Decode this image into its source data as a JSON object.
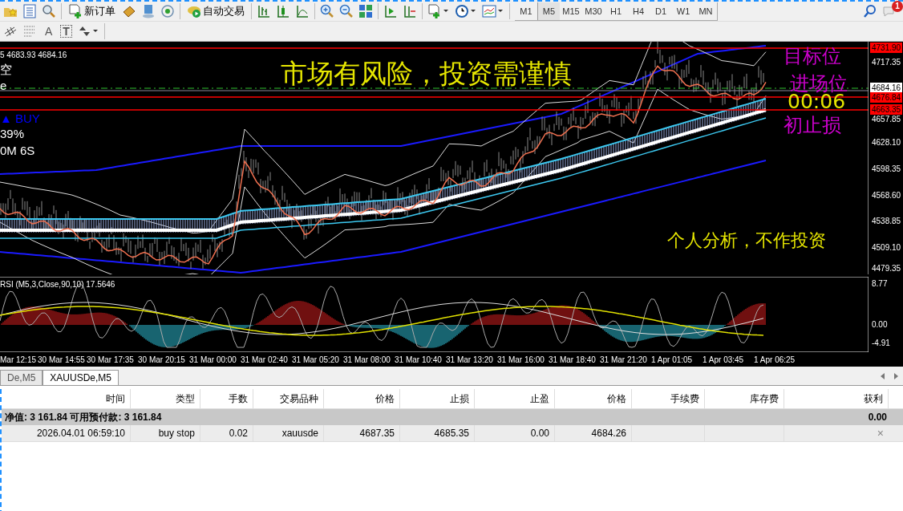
{
  "toolbar": {
    "new_order": "新订单",
    "auto_trading": "自动交易",
    "text_tools": [
      "A",
      "T"
    ],
    "timeframes": [
      {
        "label": "M1",
        "selected": false
      },
      {
        "label": "M5",
        "selected": true
      },
      {
        "label": "M15",
        "selected": false
      },
      {
        "label": "M30",
        "selected": false
      },
      {
        "label": "H1",
        "selected": false
      },
      {
        "label": "H4",
        "selected": false
      },
      {
        "label": "D1",
        "selected": false
      },
      {
        "label": "W1",
        "selected": false
      },
      {
        "label": "MN",
        "selected": false
      }
    ],
    "notification_count": "1"
  },
  "chart": {
    "quote": "5 4683.93 4684.16",
    "panel_lines": [
      {
        "text": "空",
        "color": "#ffffff"
      },
      {
        "text": "e",
        "color": "#ffffff"
      },
      {
        "text": "▲ BUY",
        "color": "#0000ff"
      },
      {
        "text": "39%",
        "color": "#ffffff"
      },
      {
        "text": "0M 6S",
        "color": "#ffffff"
      }
    ],
    "overlays": [
      {
        "text": "市场有风险，投资需谨慎",
        "color": "#e6e600"
      },
      {
        "text": "目标位",
        "color": "#cc00cc"
      },
      {
        "text": "进场位",
        "color": "#cc00cc"
      },
      {
        "text": "00:06",
        "color": "#e6e600"
      },
      {
        "text": "初止损",
        "color": "#cc00cc"
      },
      {
        "text": "个人分析，不作投资",
        "color": "#e6e600"
      }
    ],
    "price_axis": [
      {
        "label": "4731.90",
        "kind": "line"
      },
      {
        "label": "4717.35",
        "kind": "tick"
      },
      {
        "label": "4684.16",
        "kind": "bid"
      },
      {
        "label": "4676.84",
        "kind": "line"
      },
      {
        "label": "4663.35",
        "kind": "line"
      },
      {
        "label": "4657.85",
        "kind": "tick"
      },
      {
        "label": "4628.10",
        "kind": "tick"
      },
      {
        "label": "4598.35",
        "kind": "tick"
      },
      {
        "label": "4568.60",
        "kind": "tick"
      },
      {
        "label": "4538.85",
        "kind": "tick"
      },
      {
        "label": "4509.10",
        "kind": "tick"
      },
      {
        "label": "4479.35",
        "kind": "tick"
      }
    ]
  },
  "indicator": {
    "title": "RSI (M5,3,Close,90,10) 17.5646",
    "axis": [
      "8.77",
      "0.00",
      "-4.91"
    ]
  },
  "time_axis": [
    "Mar 12:15",
    "30 Mar 14:55",
    "30 Mar 17:35",
    "30 Mar 20:15",
    "31 Mar 00:00",
    "31 Mar 02:40",
    "31 Mar 05:20",
    "31 Mar 08:00",
    "31 Mar 10:40",
    "31 Mar 13:20",
    "31 Mar 16:00",
    "31 Mar 18:40",
    "31 Mar 21:20",
    "1 Apr 01:05",
    "1 Apr 03:45",
    "1 Apr 06:25"
  ],
  "tabs": [
    {
      "label": "De,M5",
      "selected": false
    },
    {
      "label": "XAUUSDe,M5",
      "selected": true
    }
  ],
  "table": {
    "columns": [
      "时间",
      "类型",
      "手数",
      "交易品种",
      "价格",
      "止损",
      "止盈",
      "价格",
      "手续费",
      "库存费",
      "获利"
    ],
    "summary": {
      "text": "净值: 3 161.84  可用预付款: 3 161.84",
      "profit": "0.00"
    },
    "rows": [
      {
        "cells": [
          "2026.04.01 06:59:10",
          "buy stop",
          "0.02",
          "xauusde",
          "4687.35",
          "4685.35",
          "0.00",
          "4684.26"
        ],
        "close": "×"
      }
    ]
  }
}
